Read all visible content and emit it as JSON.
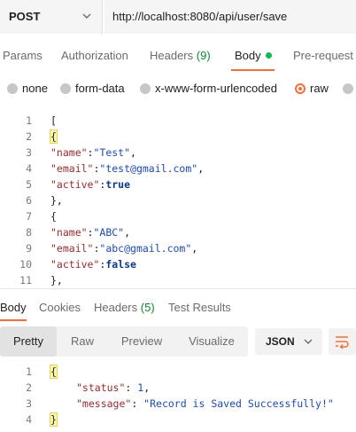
{
  "request": {
    "method": "POST",
    "url": "http://localhost:8080/api/user/save"
  },
  "request_tabs": [
    {
      "label": "Params"
    },
    {
      "label": "Authorization"
    },
    {
      "label": "Headers",
      "count": "(9)"
    },
    {
      "label": "Body",
      "active": true
    },
    {
      "label": "Pre-request"
    }
  ],
  "body_types": [
    {
      "label": "none"
    },
    {
      "label": "form-data"
    },
    {
      "label": "x-www-form-urlencoded"
    },
    {
      "label": "raw",
      "selected": true
    },
    {
      "label": ""
    }
  ],
  "request_body_lines": [
    {
      "n": "1",
      "text": "["
    },
    {
      "n": "2",
      "text": "{"
    },
    {
      "n": "3",
      "key": "\"name\"",
      "sep": ":",
      "val": "\"Test\"",
      "tail": ","
    },
    {
      "n": "4",
      "key": "\"email\"",
      "sep": ":",
      "val": "\"test@gmail.com\"",
      "tail": ","
    },
    {
      "n": "5",
      "key": "\"active\"",
      "sep": ":",
      "val": "true",
      "tail": ""
    },
    {
      "n": "6",
      "text": "},"
    },
    {
      "n": "7",
      "text": "{"
    },
    {
      "n": "8",
      "key": "\"name\"",
      "sep": ":",
      "val": "\"ABC\"",
      "tail": ","
    },
    {
      "n": "9",
      "key": "\"email\"",
      "sep": ":",
      "val": "\"abc@gmail.com\"",
      "tail": ","
    },
    {
      "n": "10",
      "key": "\"active\"",
      "sep": ":",
      "val": "false",
      "tail": ""
    },
    {
      "n": "11",
      "text": "},"
    }
  ],
  "response_tabs": [
    {
      "label": "Body",
      "active": true
    },
    {
      "label": "Cookies"
    },
    {
      "label": "Headers",
      "count": "(5)"
    },
    {
      "label": "Test Results"
    }
  ],
  "response_views": [
    {
      "label": "Pretty",
      "active": true
    },
    {
      "label": "Raw"
    },
    {
      "label": "Preview"
    },
    {
      "label": "Visualize"
    }
  ],
  "response_format": "JSON",
  "response_body_lines": [
    {
      "n": "1",
      "text": "{"
    },
    {
      "n": "2",
      "key": "\"status\"",
      "sep": ": ",
      "val": "1",
      "tail": ","
    },
    {
      "n": "3",
      "key": "\"message\"",
      "sep": ": ",
      "val": "\"Record is Saved Successfully!\"",
      "tail": ""
    },
    {
      "n": "4",
      "text": "}"
    }
  ],
  "colors": {
    "accent": "#ff6c37",
    "count_green": "#0a8a2e",
    "status_dot": "#0cbb52"
  },
  "icons": [
    "chevron-down-icon",
    "status-dot-icon",
    "wrap-lines-icon"
  ]
}
